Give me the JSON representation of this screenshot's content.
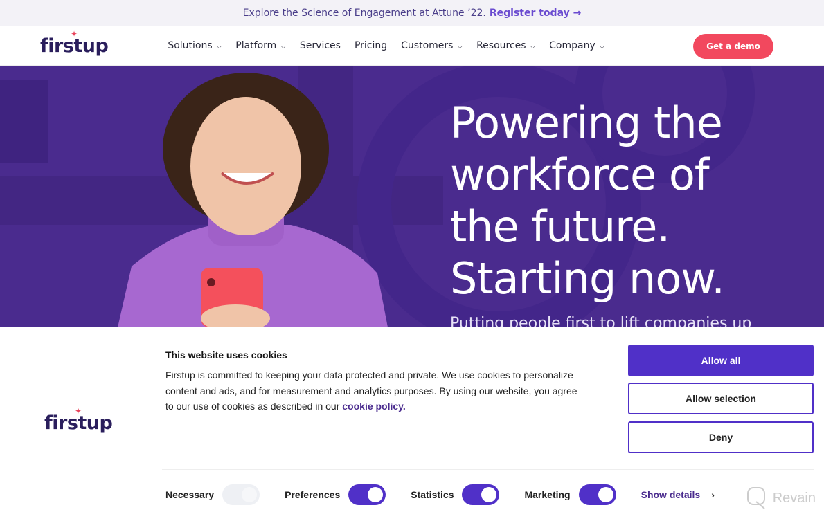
{
  "promo": {
    "text": "Explore the Science of Engagement at Attune ’22.",
    "link": "Register today →"
  },
  "nav": {
    "logo": "firstup",
    "items": [
      {
        "label": "Solutions",
        "dropdown": true
      },
      {
        "label": "Platform",
        "dropdown": true
      },
      {
        "label": "Services",
        "dropdown": false
      },
      {
        "label": "Pricing",
        "dropdown": false
      },
      {
        "label": "Customers",
        "dropdown": true
      },
      {
        "label": "Resources",
        "dropdown": true
      },
      {
        "label": "Company",
        "dropdown": true
      }
    ],
    "cta": "Get a demo"
  },
  "hero": {
    "line1": "Powering the",
    "line2": "workforce of",
    "line3": "the future.",
    "line4": "Starting now.",
    "subtitle": "Putting people first to lift companies up"
  },
  "cookie": {
    "logo": "firstup",
    "title": "This website uses cookies",
    "text": "Firstup is committed to keeping your data protected and private. We use cookies to personalize content and ads, and for measurement and analytics purposes. By using our website, you agree to our use of cookies as described in our ",
    "link": "cookie policy.",
    "allow_all": "Allow all",
    "allow_selection": "Allow selection",
    "deny": "Deny",
    "toggles": [
      {
        "label": "Necessary",
        "on": true,
        "disabled": true
      },
      {
        "label": "Preferences",
        "on": true
      },
      {
        "label": "Statistics",
        "on": true
      },
      {
        "label": "Marketing",
        "on": true
      }
    ],
    "show_details": "Show details"
  },
  "watermark": "Revain",
  "colors": {
    "accent": "#5030c8",
    "cta": "#f2485e",
    "hero": "#4a2b8e"
  }
}
